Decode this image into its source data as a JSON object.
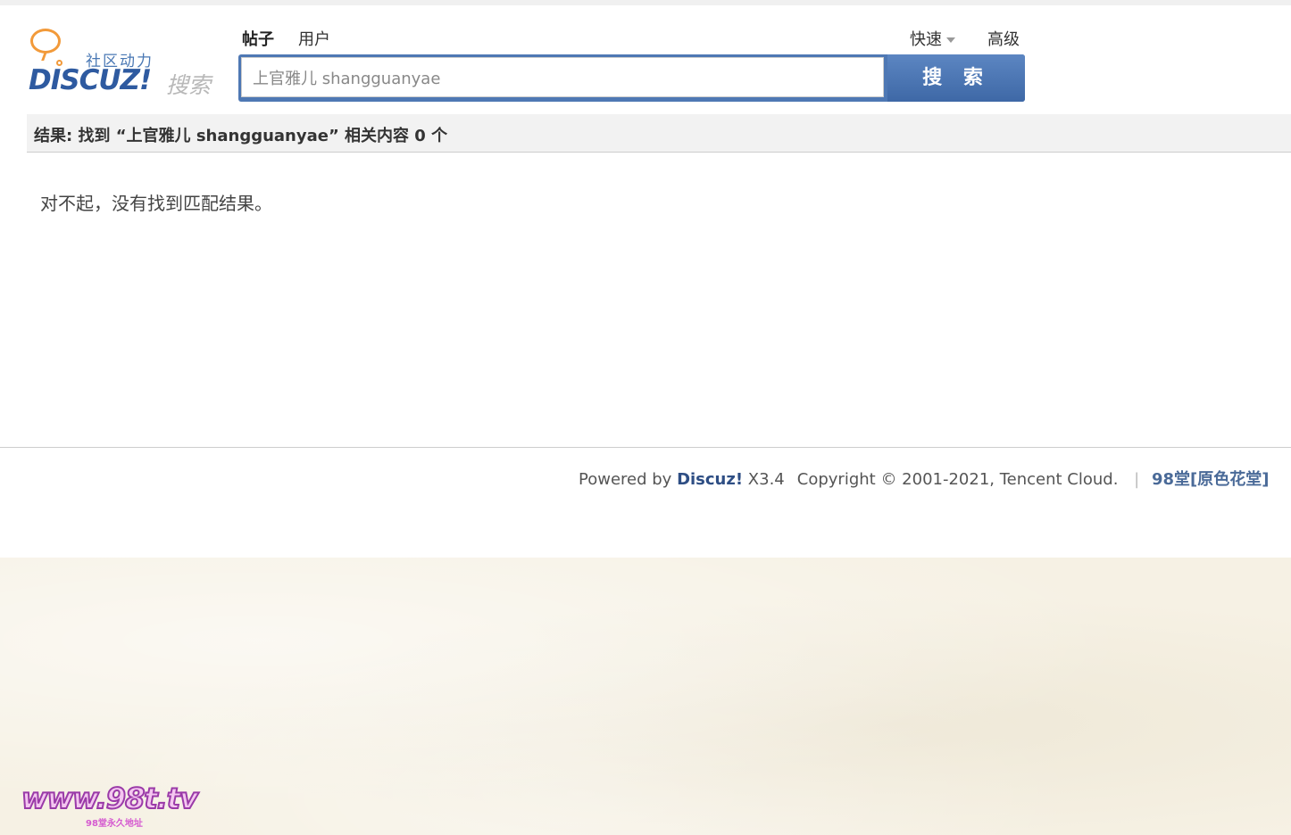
{
  "logo": {
    "subtitle": "社区动力",
    "brand": "DISCUZ!",
    "search_label": "搜索"
  },
  "tabs": {
    "posts": "帖子",
    "users": "用户"
  },
  "quick_label": "快速",
  "advanced_label": "高级",
  "search": {
    "value": "上官雅儿 shangguanyae",
    "button": "搜 索"
  },
  "result": {
    "summary": "结果: 找到 “上官雅儿 shangguanyae” 相关内容 0 个",
    "empty_message": "对不起，没有找到匹配结果。"
  },
  "footer": {
    "powered_by": "Powered by",
    "brand": "Discuz!",
    "version": "X3.4",
    "copyright": "Copyright © 2001-2021, Tencent Cloud.",
    "separator": "|",
    "site_name": "98堂[原色花堂]"
  },
  "watermark": {
    "text": "www.98t.tv",
    "subtext": "98堂永久地址"
  }
}
